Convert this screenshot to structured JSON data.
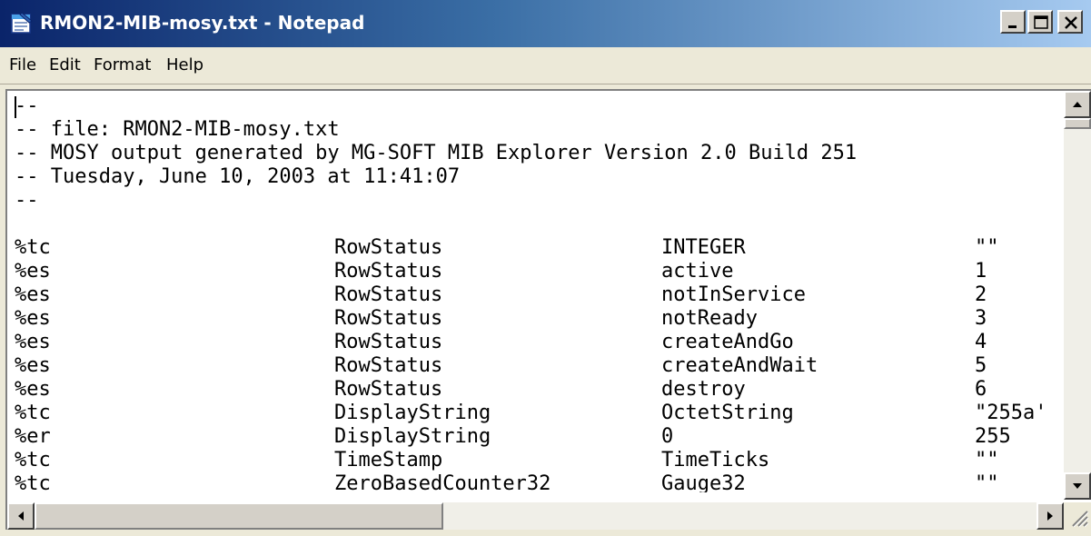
{
  "window": {
    "title": "RMON2-MIB-mosy.txt - Notepad",
    "icon": "notepad-icon"
  },
  "menu": [
    "File",
    "Edit",
    "Format",
    "Help"
  ],
  "header_lines": [
    "--",
    "-- file: RMON2-MIB-mosy.txt",
    "-- MOSY output generated by MG-SOFT MIB Explorer Version 2.0 Build 251",
    "-- Tuesday, June 10, 2003 at 11:41:07",
    "--"
  ],
  "rows": [
    [
      "%tc",
      "RowStatus",
      "INTEGER",
      "\"\""
    ],
    [
      "%es",
      "RowStatus",
      "active",
      "1"
    ],
    [
      "%es",
      "RowStatus",
      "notInService",
      "2"
    ],
    [
      "%es",
      "RowStatus",
      "notReady",
      "3"
    ],
    [
      "%es",
      "RowStatus",
      "createAndGo",
      "4"
    ],
    [
      "%es",
      "RowStatus",
      "createAndWait",
      "5"
    ],
    [
      "%es",
      "RowStatus",
      "destroy",
      "6"
    ],
    [
      "%tc",
      "DisplayString",
      "OctetString",
      "\"255a'"
    ],
    [
      "%er",
      "DisplayString",
      "0",
      "255"
    ],
    [
      "%tc",
      "TimeStamp",
      "TimeTicks",
      "\"\""
    ],
    [
      "%tc",
      "ZeroBasedCounter32",
      "Gauge32",
      "\"\""
    ]
  ]
}
